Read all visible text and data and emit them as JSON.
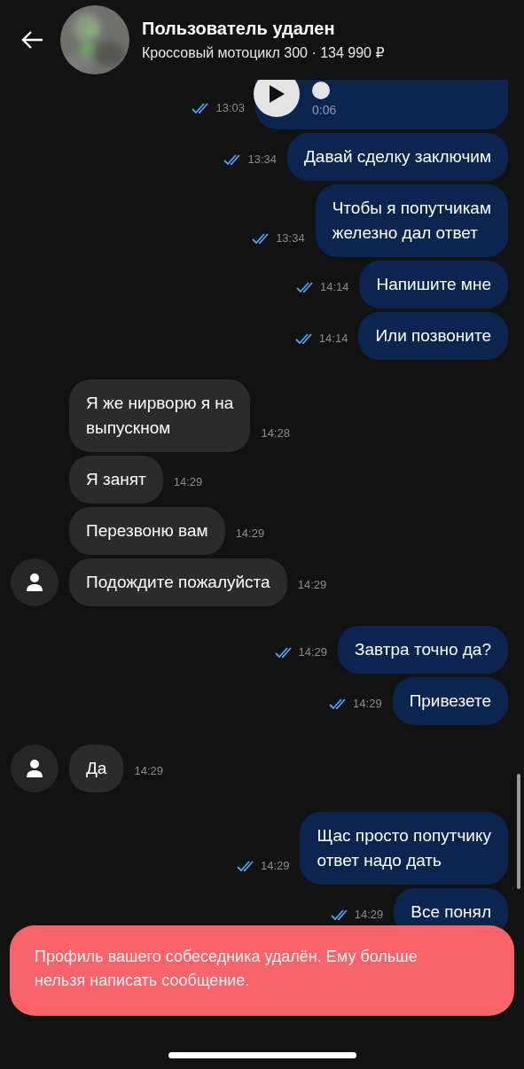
{
  "header": {
    "title": "Пользователь удален",
    "subtitle": "Кроссовый мотоцикл 300 · 134 990 ₽"
  },
  "groups": [
    {
      "outgoing": true,
      "messages": [
        {
          "kind": "voice",
          "duration": "0:06",
          "time": "13:03",
          "read": true
        },
        {
          "kind": "text",
          "text": "Давай сделку заключим",
          "time": "13:34",
          "read": true
        },
        {
          "kind": "text",
          "text": "Чтобы я попутчикам\nжелезно дал ответ",
          "time": "13:34",
          "read": true
        },
        {
          "kind": "text",
          "text": "Напишите мне",
          "time": "14:14",
          "read": true
        },
        {
          "kind": "text",
          "text": "Или позвоните",
          "time": "14:14",
          "read": true
        }
      ]
    },
    {
      "outgoing": false,
      "messages": [
        {
          "kind": "text",
          "text": "Я же нирворю я на\nвыпускном",
          "time": "14:28"
        },
        {
          "kind": "text",
          "text": "Я занят",
          "time": "14:29"
        },
        {
          "kind": "text",
          "text": "Перезвоню вам",
          "time": "14:29"
        },
        {
          "kind": "text",
          "text": "Подождите пожалуйста",
          "time": "14:29"
        }
      ]
    },
    {
      "outgoing": true,
      "messages": [
        {
          "kind": "text",
          "text": "Завтра точно да?",
          "time": "14:29",
          "read": true
        },
        {
          "kind": "text",
          "text": "Привезете",
          "time": "14:29",
          "read": true
        }
      ]
    },
    {
      "outgoing": false,
      "messages": [
        {
          "kind": "text",
          "text": "Да",
          "time": "14:29"
        }
      ]
    },
    {
      "outgoing": true,
      "messages": [
        {
          "kind": "text",
          "text": "Щас просто попутчику\nответ надо дать",
          "time": "14:29",
          "read": true
        },
        {
          "kind": "text",
          "text": "Все понял",
          "time": "14:29",
          "read": true
        }
      ]
    }
  ],
  "toast": {
    "text": "Профиль вашего собеседника удалён. Ему больше нельзя написать сообщение."
  }
}
